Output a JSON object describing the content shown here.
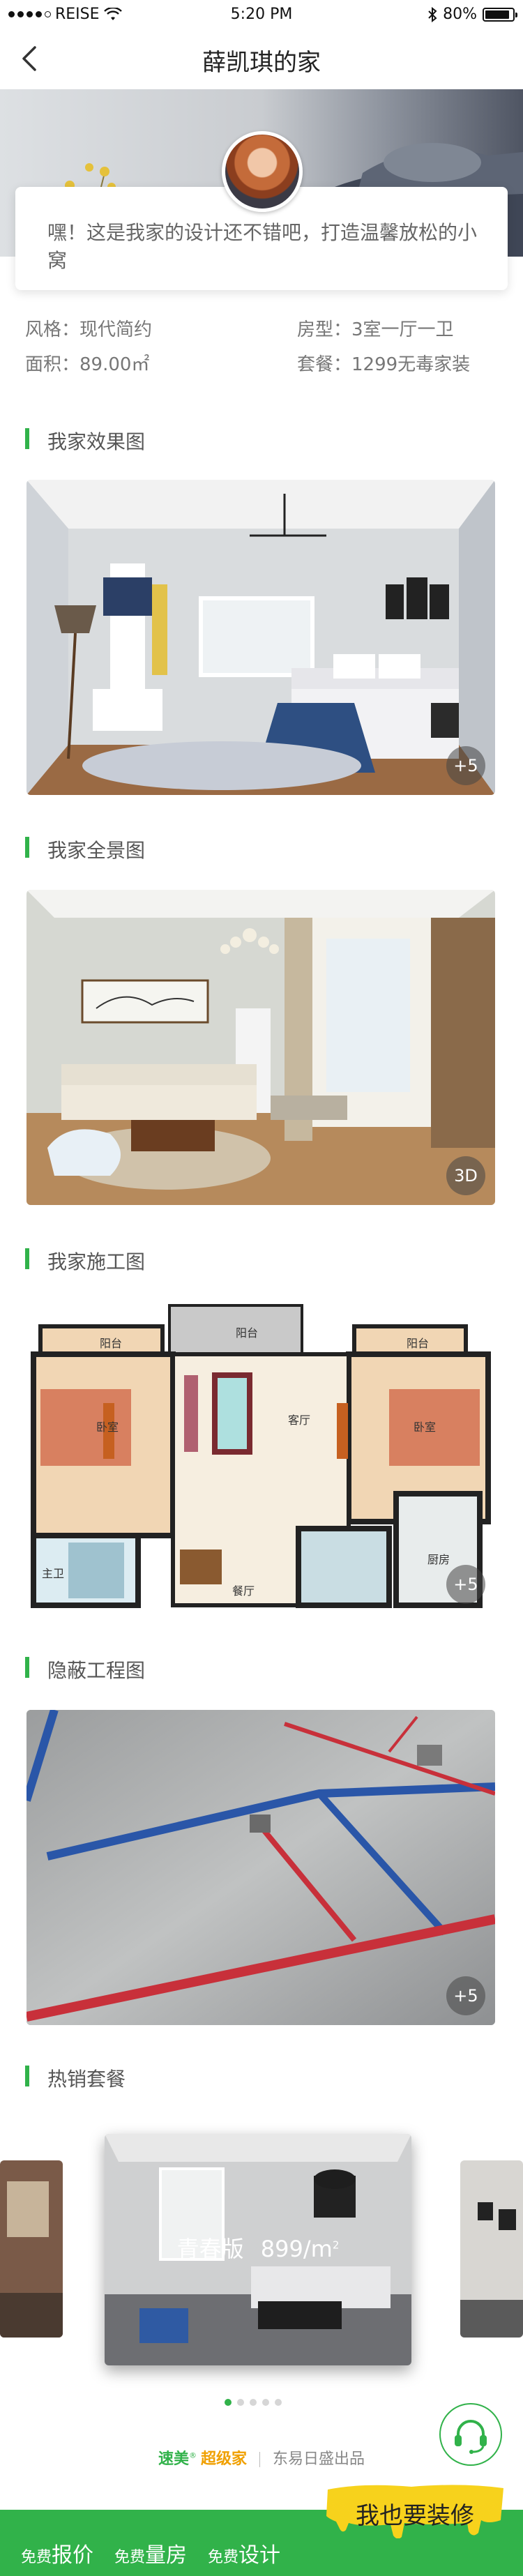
{
  "status_bar": {
    "carrier": "REISE",
    "time": "5:20 PM",
    "battery": "80%"
  },
  "nav": {
    "title": "薛凯琪的家"
  },
  "intro": {
    "text": "嘿！这是我家的设计还不错吧，打造温馨放松的小窝"
  },
  "info": {
    "style_label": "风格：现代简约",
    "layout_label": "房型：3室一厅一卫",
    "area_label": "面积：89.00㎡",
    "package_label": "套餐：1299无毒家装"
  },
  "sections": {
    "render": {
      "title": "我家效果图",
      "badge": "+5"
    },
    "panorama": {
      "title": "我家全景图",
      "badge": "3D"
    },
    "construction": {
      "title": "我家施工图",
      "badge": "+5"
    },
    "hidden": {
      "title": "隐蔽工程图",
      "badge": "+5"
    },
    "hot": {
      "title": "热销套餐"
    }
  },
  "floorplan_labels": {
    "balcony1": "阳台",
    "balcony2": "阳台",
    "balcony3": "阳台",
    "bedroom1": "卧室",
    "bedroom2": "卧室",
    "living": "客厅",
    "bath": "主卫",
    "dining": "餐厅",
    "kitchen": "厨房"
  },
  "carousel": {
    "name": "青春版",
    "price": "899",
    "unit": "/m",
    "unit_sup": "2"
  },
  "brand": {
    "part1": "速美",
    "mark": "®",
    "part2": "超级家",
    "maker": "东易日盛出品"
  },
  "bottom_bar": {
    "quote_small": "免费",
    "quote_big": "报价",
    "measure_small": "免费",
    "measure_big": "量房",
    "design_small": "免费",
    "design_big": "设计",
    "cta": "我也要装修"
  },
  "colors": {
    "accent": "#31b24a",
    "cta_yellow": "#f7d21c"
  }
}
